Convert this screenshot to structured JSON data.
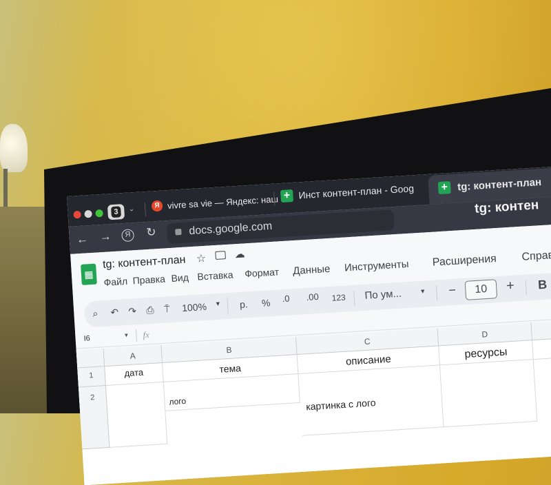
{
  "browser": {
    "tab_count": "3",
    "tabs": [
      {
        "label": "vivre sa vie — Яндекс: наш",
        "icon": "yandex-icon",
        "icon_text": "Я"
      },
      {
        "label": "Инст контент-план - Goog",
        "icon": "google-sheets-icon"
      },
      {
        "label": "tg: контент-план",
        "icon": "google-sheets-icon",
        "active": true
      }
    ],
    "window_title": "tg: контен",
    "address": "docs.google.com",
    "nav": {
      "back": "←",
      "forward": "→",
      "yandex": "Я",
      "reload": "↻"
    }
  },
  "sheets": {
    "doc_title": "tg: контент-план",
    "menu": [
      "Файл",
      "Правка",
      "Вид",
      "Вставка",
      "Формат",
      "Данные",
      "Инструменты",
      "Расширения",
      "Справ"
    ],
    "toolbar": {
      "zoom": "100%",
      "currency": "р.",
      "percent": "%",
      "dec_less": ".0",
      "dec_more": ".00",
      "format_123": "123",
      "font": "По ум...",
      "font_size": "10",
      "size_minus": "−",
      "size_plus": "+",
      "bold": "B"
    },
    "name_box": "I6",
    "fx": "fx",
    "columns": [
      "A",
      "B",
      "C",
      "D"
    ],
    "rows": [
      "1",
      "2"
    ],
    "cells": {
      "A1": "дата",
      "B1": "тема",
      "C1": "описание",
      "D1": "ресурсы",
      "B2": "лого",
      "C2": "картинка с лого"
    }
  },
  "colors": {
    "wall": "#d9b23a",
    "tabbar": "#25272e",
    "sheets_green": "#23a455",
    "yandex_red": "#e8472b"
  }
}
